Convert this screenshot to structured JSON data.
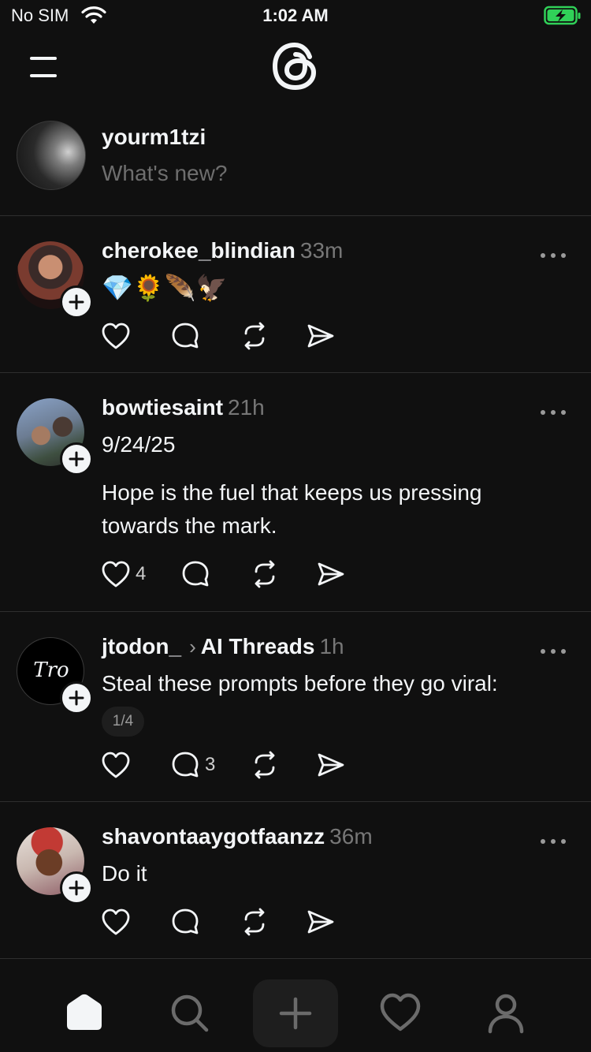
{
  "status_bar": {
    "carrier": "No SIM",
    "time": "1:02 AM",
    "battery_color": "#30d158"
  },
  "composer": {
    "username": "yourm1tzi",
    "placeholder": "What's new?"
  },
  "posts": [
    {
      "username": "cherokee_blindian",
      "time": "33m",
      "text": "💎🌻🪶🦅",
      "likes": "",
      "replies": ""
    },
    {
      "username": "bowtiesaint",
      "time": "21h",
      "date_line": "9/24/25",
      "text": "Hope is the fuel that keeps us pressing towards the mark.",
      "likes": "4",
      "replies": ""
    },
    {
      "username": "jtodon_",
      "community": "AI Threads",
      "time": "1h",
      "text": "Steal these prompts before they go viral:",
      "pager": "1/4",
      "likes": "",
      "replies": "3",
      "avatar_mark": "Tro"
    },
    {
      "username": "shavontaaygotfaanzz",
      "time": "36m",
      "text": "Do it",
      "likes": "",
      "replies": ""
    }
  ],
  "tabbar": {
    "items": [
      "home-icon",
      "search-icon",
      "create-icon",
      "activity-icon",
      "profile-icon"
    ]
  }
}
